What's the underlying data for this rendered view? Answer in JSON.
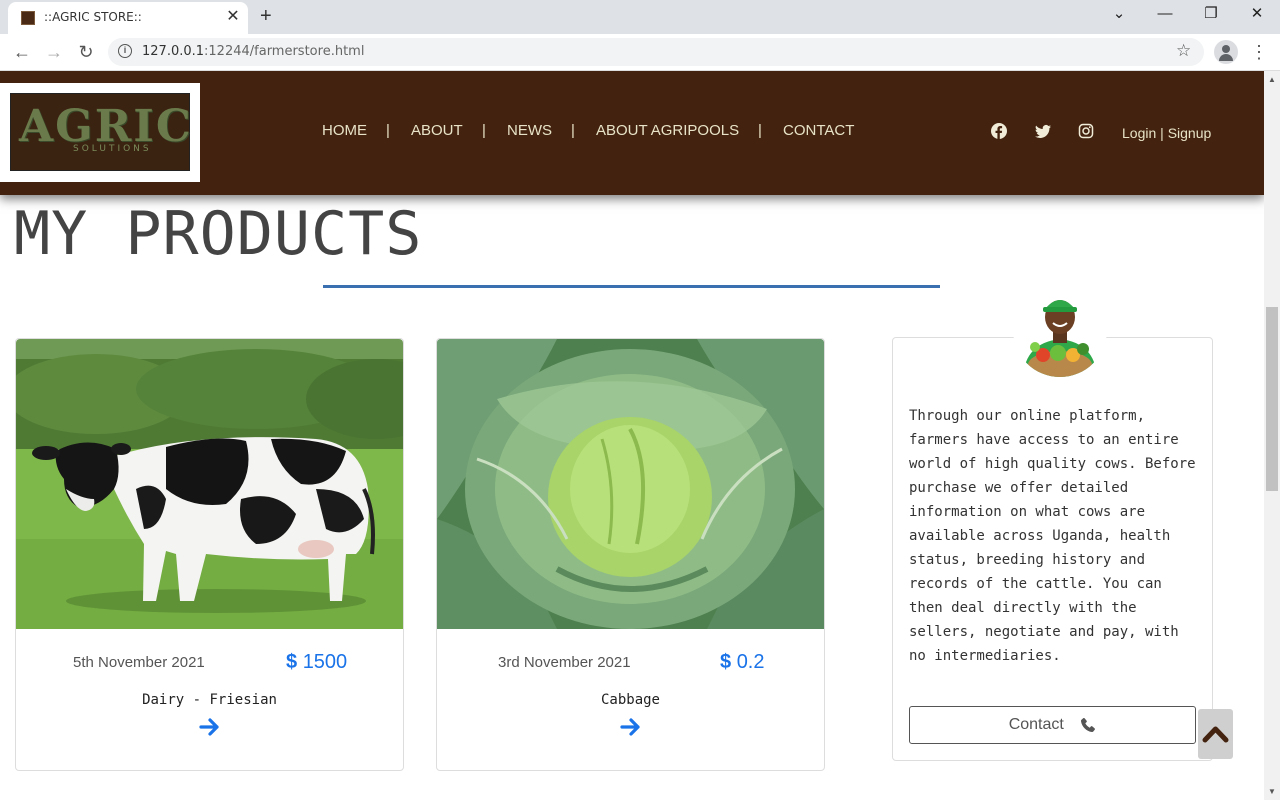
{
  "browser": {
    "tab_title": "::AGRIC STORE::",
    "tab_close": "✕",
    "new_tab": "+",
    "url_host": "127.0.0.1",
    "url_rest": ":12244/farmerstore.html",
    "window_controls": {
      "dropdown": "⌄",
      "minimize": "—",
      "restore": "❐",
      "close": "✕"
    },
    "nav": {
      "back": "←",
      "forward": "→",
      "reload": "↻"
    },
    "info": "i",
    "star": "☆",
    "menu": "⋮"
  },
  "header": {
    "logo_text": "AGRIC",
    "logo_sub": "SOLUTIONS",
    "nav_items": [
      "HOME",
      "ABOUT",
      "NEWS",
      "ABOUT AGRIPOOLS",
      "CONTACT"
    ],
    "nav_separator": "|",
    "social_icons": [
      "facebook-icon",
      "twitter-icon",
      "instagram-icon"
    ],
    "login": "Login",
    "auth_separator": "|",
    "signup": "Signup"
  },
  "main": {
    "title": "MY PRODUCTS",
    "accent_color": "#3a6fb0",
    "header_color": "#43230f",
    "price_color": "#1a73e8"
  },
  "products": [
    {
      "date": "5th November 2021",
      "currency": "$",
      "price": "1500",
      "name": "Dairy - Friesian",
      "image": "cow-image"
    },
    {
      "date": "3rd November 2021",
      "currency": "$",
      "price": "0.2",
      "name": "Cabbage",
      "image": "cabbage-image"
    }
  ],
  "info_card": {
    "text": "Through our online platform, farmers have access to an entire world of high quality cows. Before purchase we offer detailed information on what cows are available across Uganda, health status, breeding history and records of the cattle. You can then deal directly with the sellers, negotiate and pay, with no intermediaries.",
    "contact_label": "Contact",
    "avatar": "farmer-avatar"
  },
  "back_to_top": "chevron-up-icon"
}
